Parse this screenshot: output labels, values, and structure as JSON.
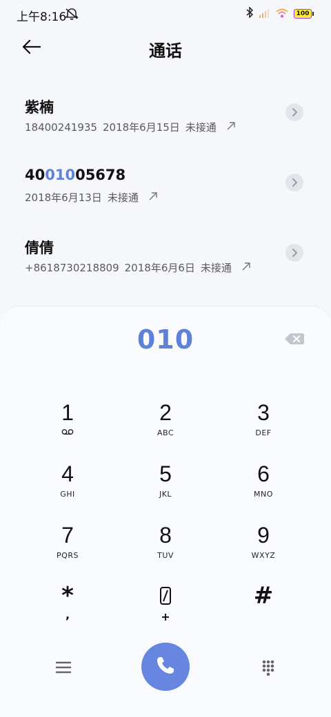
{
  "status_bar": {
    "time": "上午8:16",
    "battery": "100"
  },
  "header": {
    "title": "通话"
  },
  "calls": [
    {
      "name": "紫楠",
      "number": "18400241935",
      "date": "2018年6月15日",
      "status": "未接通"
    },
    {
      "name_prefix": "40",
      "name_highlight": "010",
      "name_suffix": "05678",
      "date": "2018年6月13日",
      "status": "未接通"
    },
    {
      "name": "倩倩",
      "number": "+8618730218809",
      "date": "2018年6月6日",
      "status": "未接通"
    }
  ],
  "dialpad": {
    "entered": "010",
    "keys": [
      {
        "digit": "1",
        "letters": ""
      },
      {
        "digit": "2",
        "letters": "ABC"
      },
      {
        "digit": "3",
        "letters": "DEF"
      },
      {
        "digit": "4",
        "letters": "GHI"
      },
      {
        "digit": "5",
        "letters": "JKL"
      },
      {
        "digit": "6",
        "letters": "MNO"
      },
      {
        "digit": "7",
        "letters": "PQRS"
      },
      {
        "digit": "8",
        "letters": "TUV"
      },
      {
        "digit": "9",
        "letters": "WXYZ"
      },
      {
        "digit": "*",
        "letters": ","
      },
      {
        "digit": "0",
        "letters": "+"
      },
      {
        "digit": "#",
        "letters": ""
      }
    ]
  },
  "icons": {
    "back": "arrow-left-icon",
    "info": "chevron-right-icon",
    "backspace": "backspace-icon",
    "voicemail": "voicemail-icon",
    "call": "phone-icon",
    "menu": "menu-icon",
    "keypad": "keypad-icon"
  },
  "colors": {
    "accent": "#5f82d8",
    "call_button": "#6686df",
    "background": "#f6f7fb"
  }
}
